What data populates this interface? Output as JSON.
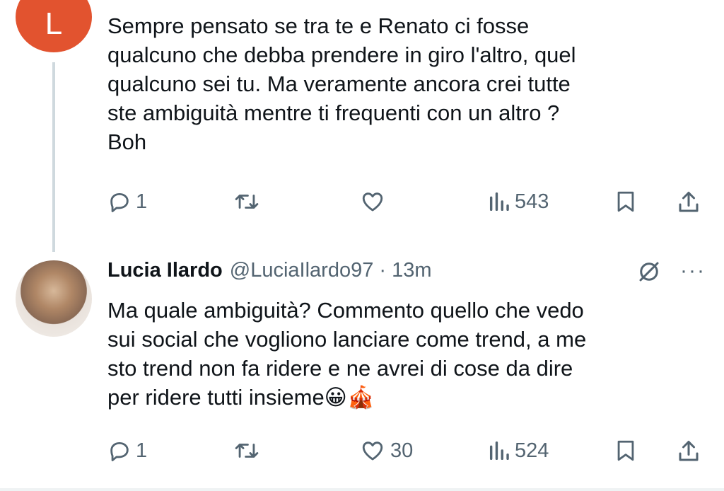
{
  "reply_parent": {
    "avatar_letter": "L",
    "avatar_color": "#e2532f",
    "text": "Sempre pensato se tra te e Renato ci fosse\nqualcuno che debba prendere in giro l'altro, quel\nqualcuno sei tu. Ma veramente ancora crei tutte\nste ambiguità mentre ti frequenti con un altro ?\nBoh",
    "actions": {
      "replies": "1",
      "reposts": "",
      "likes": "",
      "views": "543"
    }
  },
  "reply": {
    "author_name": "Lucia Ilardo",
    "handle_time": "@LuciaIlardo97 · 13m",
    "text": "Ma quale ambiguità? Commento quello che vedo\nsui social che vogliono lanciare come trend, a me\nsto trend non fa ridere e ne avrei di cose da dire\nper ridere tutti insieme😀🎪",
    "actions": {
      "replies": "1",
      "reposts": "",
      "likes": "30",
      "views": "524"
    }
  },
  "icons": [
    "reply-icon",
    "repost-icon",
    "like-icon",
    "views-icon",
    "bookmark-icon",
    "share-icon",
    "grok-icon",
    "more-icon"
  ],
  "colors": {
    "text": "#0f1419",
    "secondary": "#536471",
    "thread_line": "#cfd9de"
  }
}
